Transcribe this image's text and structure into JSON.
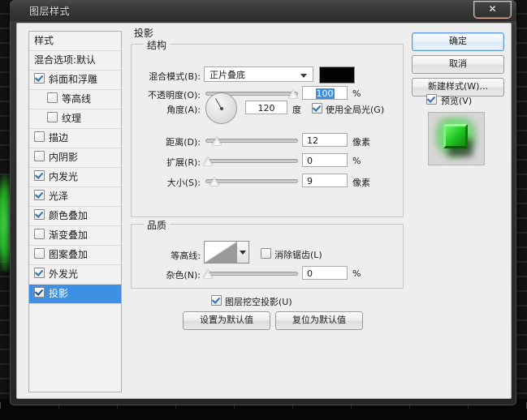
{
  "window": {
    "title": "图层样式",
    "close_label": "✕"
  },
  "styles_panel": {
    "header": "样式",
    "blending_options": "混合选项:默认",
    "items": [
      {
        "label": "斜面和浮雕",
        "checked": true,
        "sub": false,
        "selected": false
      },
      {
        "label": "等高线",
        "checked": false,
        "sub": true,
        "selected": false
      },
      {
        "label": "纹理",
        "checked": false,
        "sub": true,
        "selected": false
      },
      {
        "label": "描边",
        "checked": false,
        "sub": false,
        "selected": false
      },
      {
        "label": "内阴影",
        "checked": false,
        "sub": false,
        "selected": false
      },
      {
        "label": "内发光",
        "checked": true,
        "sub": false,
        "selected": false
      },
      {
        "label": "光泽",
        "checked": true,
        "sub": false,
        "selected": false
      },
      {
        "label": "颜色叠加",
        "checked": true,
        "sub": false,
        "selected": false
      },
      {
        "label": "渐变叠加",
        "checked": false,
        "sub": false,
        "selected": false
      },
      {
        "label": "图案叠加",
        "checked": false,
        "sub": false,
        "selected": false
      },
      {
        "label": "外发光",
        "checked": true,
        "sub": false,
        "selected": false
      },
      {
        "label": "投影",
        "checked": true,
        "sub": false,
        "selected": true
      }
    ]
  },
  "main": {
    "panel_title": "投影",
    "structure": {
      "title": "结构",
      "blend_mode_label": "混合模式(B):",
      "blend_mode_value": "正片叠底",
      "shadow_color": "#030303",
      "opacity_label": "不透明度(O):",
      "opacity_value": "100",
      "opacity_unit": "%",
      "angle_label": "角度(A):",
      "angle_value": "120",
      "angle_unit": "度",
      "global_light_label": "使用全局光(G)",
      "global_light_checked": true,
      "distance_label": "距离(D):",
      "distance_value": "12",
      "distance_unit": "像素",
      "spread_label": "扩展(R):",
      "spread_value": "0",
      "spread_unit": "%",
      "size_label": "大小(S):",
      "size_value": "9",
      "size_unit": "像素"
    },
    "quality": {
      "title": "品质",
      "contour_label": "等高线:",
      "antialias_label": "消除锯齿(L)",
      "antialias_checked": false,
      "noise_label": "杂色(N):",
      "noise_value": "0",
      "noise_unit": "%"
    },
    "knockout_label": "图层挖空投影(U)",
    "knockout_checked": true,
    "set_default_button": "设置为默认值",
    "reset_default_button": "复位为默认值"
  },
  "right": {
    "ok_button": "确定",
    "cancel_button": "取消",
    "new_style_button": "新建样式(W)...",
    "preview_label": "预览(V)",
    "preview_checked": true
  },
  "colors": {
    "accent_selection": "#3d90e3",
    "dialog_bg": "#eeeeee",
    "titlebar": "#393939",
    "close_red": "#c9301a",
    "preview_green": "#22c822"
  }
}
